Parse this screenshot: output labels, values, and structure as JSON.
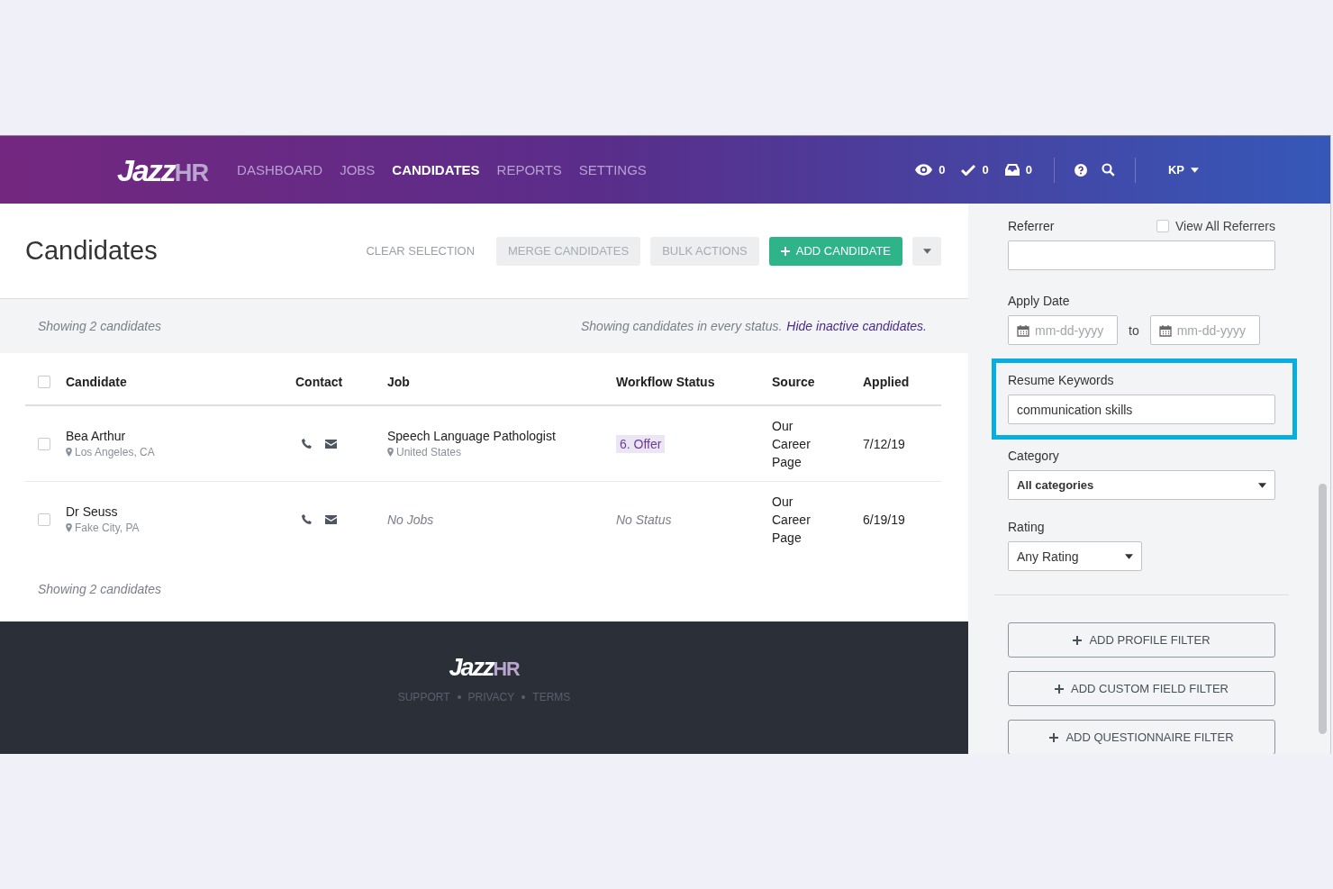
{
  "nav": {
    "logo": {
      "main": "Jazz",
      "accent": "HR"
    },
    "items": [
      {
        "label": "DASHBOARD",
        "selected": false
      },
      {
        "label": "JOBS",
        "selected": false
      },
      {
        "label": "CANDIDATES",
        "selected": true
      },
      {
        "label": "REPORTS",
        "selected": false
      },
      {
        "label": "SETTINGS",
        "selected": false
      }
    ],
    "counters": [
      {
        "kind": "views",
        "count": "0"
      },
      {
        "kind": "tasks",
        "count": "0"
      },
      {
        "kind": "inbox",
        "count": "0"
      }
    ],
    "user": "KP"
  },
  "page": {
    "title": "Candidates",
    "actions": [
      {
        "kind": "link",
        "label": "CLEAR SELECTION"
      },
      {
        "kind": "muted",
        "label": "MERGE CANDIDATES"
      },
      {
        "kind": "muted",
        "label": "BULK ACTIONS"
      },
      {
        "kind": "primary",
        "label": "ADD CANDIDATE"
      },
      {
        "kind": "menu"
      }
    ]
  },
  "summary": {
    "count": "Showing 2 candidates",
    "note": "Showing candidates in every status.",
    "link": "Hide inactive candidates."
  },
  "table": {
    "select_all": {
      "checked": false
    },
    "columns": [
      "Candidate",
      "Contact",
      "Job",
      "Workflow Status",
      "Source",
      "Applied"
    ],
    "rows": [
      {
        "checked": false,
        "name": "Bea Arthur",
        "location": "Los Angeles, CA",
        "job": {
          "kind": "job",
          "title": "Speech Language Pathologist",
          "location": "United States"
        },
        "status": {
          "kind": "stage",
          "label": "6. Offer"
        },
        "source": "Our Career Page",
        "applied": "7/12/19"
      },
      {
        "checked": false,
        "name": "Dr Seuss",
        "location": "Fake City, PA",
        "job": {
          "kind": "empty",
          "title": "No Jobs"
        },
        "status": {
          "kind": "empty",
          "label": "No Status"
        },
        "source": "Our Career Page",
        "applied": "6/19/19"
      }
    ]
  },
  "bottom_count": "Showing 2 candidates",
  "footer": {
    "logo": {
      "main": "Jazz",
      "accent": "HR"
    },
    "links": [
      "SUPPORT",
      "PRIVACY",
      "TERMS"
    ]
  },
  "filters": [
    {
      "kind": "text",
      "label": "Referrer",
      "option": {
        "label": "View All Referrers",
        "checked": false
      }
    },
    {
      "kind": "daterange",
      "label": "Apply Date",
      "from_placeholder": "mm-dd-yyyy",
      "separator": "to",
      "to_placeholder": "mm-dd-yyyy"
    },
    {
      "kind": "text",
      "label": "Resume Keywords",
      "value": "communication skills",
      "highlighted": true
    },
    {
      "kind": "select",
      "label": "Category",
      "value": "All categories"
    },
    {
      "kind": "short-select",
      "label": "Rating",
      "value": "Any Rating"
    }
  ],
  "filter_buttons": [
    "ADD PROFILE FILTER",
    "ADD CUSTOM FIELD FILTER",
    "ADD QUESTIONNAIRE FILTER"
  ]
}
